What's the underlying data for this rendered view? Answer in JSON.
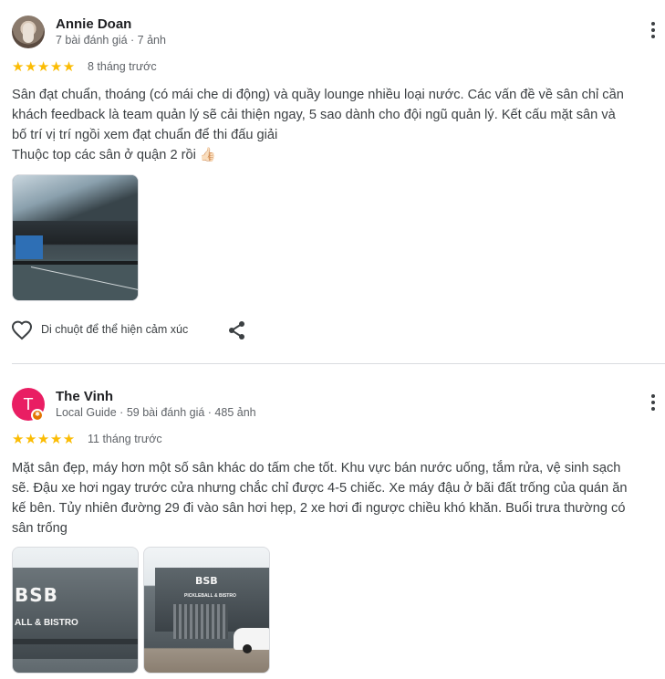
{
  "reviews": [
    {
      "author": "Annie Doan",
      "meta": "7 bài đánh giá · 7 ảnh",
      "stars": "★★★★★",
      "time": "8 tháng trước",
      "text_lines": [
        "Sân đạt chuẩn, thoáng (có mái che di động) và quầy lounge nhiều loại nước. Các vấn đề về sân chỉ cần",
        "khách feedback là team quản lý sẽ cải thiện ngay, 5 sao dành cho đội ngũ quản lý. Kết cấu mặt sân và",
        "bố trí vị trí ngồi xem đạt chuẩn để thi đấu giải",
        "Thuộc top các sân ở quận 2 rồi 👍🏻"
      ],
      "reaction_label": "Di chuột để thể hiện cảm xúc"
    },
    {
      "author": "The Vinh",
      "avatar_letter": "T",
      "meta": "Local Guide · 59 bài đánh giá · 485 ảnh",
      "stars": "★★★★★",
      "time": "11 tháng trước",
      "text_lines": [
        "Mặt sân đẹp, máy hơn một số sân khác do tấm che tốt. Khu vực bán nước uống, tắm rửa, vệ sinh sạch",
        "sẽ. Đậu xe hơi ngay trước cửa nhưng chắc chỉ được 4-5 chiếc. Xe máy đậu ở bãi đất trống của quán ăn",
        "kế bên. Tủy nhiên đường 29 đi vào sân hơi hẹp, 2 xe hơi đi ngược chiều khó khăn. Buổi trưa thường có",
        "sân trống"
      ],
      "photo_signs": [
        "BSB",
        "PICKLEBALL & BISTRO",
        "ALL & BISTRO"
      ]
    }
  ],
  "colors": {
    "star": "#fbbc04",
    "avatar_t": "#e91e63",
    "local_guide_badge": "#e37400"
  }
}
